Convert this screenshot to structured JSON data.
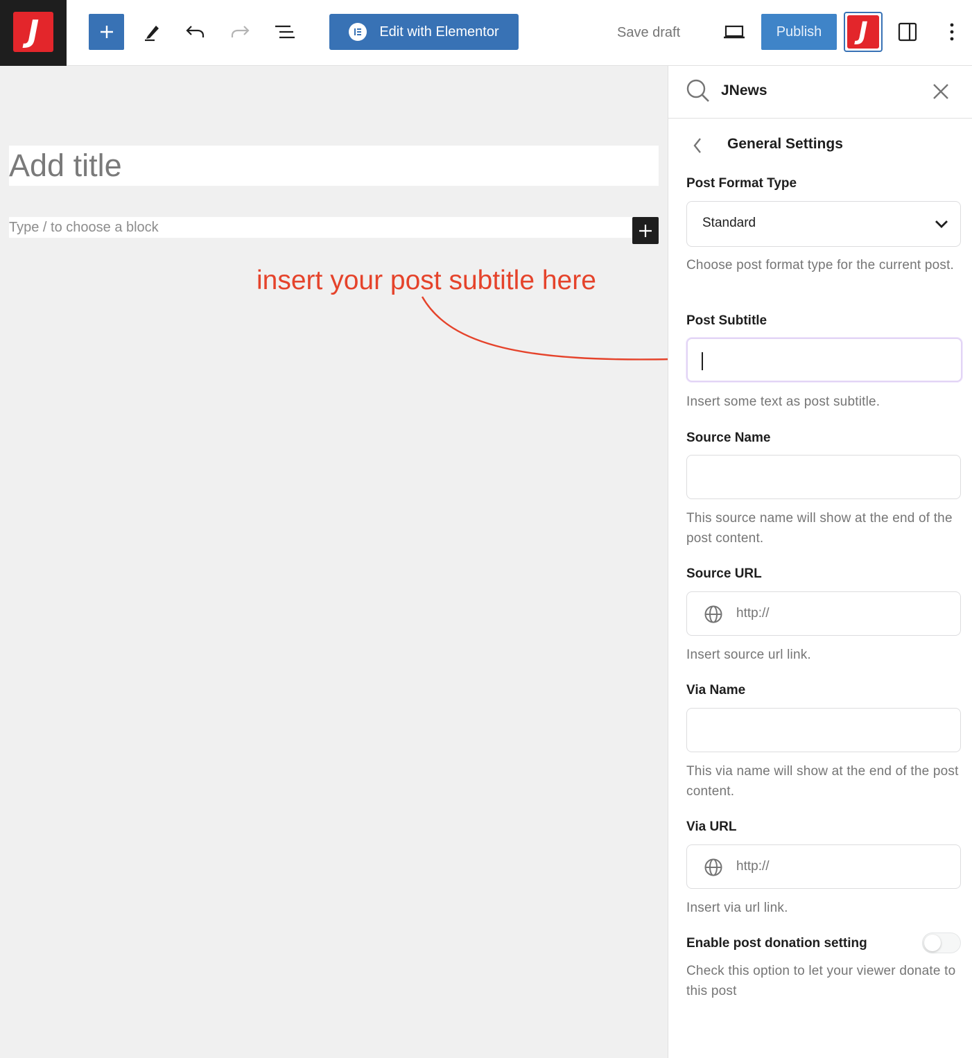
{
  "toolbar": {
    "logo_letter": "J",
    "add_block_label": "+",
    "edit_elementor_label": "Edit with Elementor",
    "save_draft_label": "Save draft",
    "publish_label": "Publish",
    "jnews_toggle_letter": "J"
  },
  "editor": {
    "title_placeholder": "Add title",
    "block_placeholder": "Type / to choose a block",
    "annotation": "insert your post subtitle here"
  },
  "sidebar": {
    "header_title": "JNews",
    "section_title": "General Settings",
    "post_format": {
      "label": "Post Format Type",
      "value": "Standard",
      "help": "Choose post format type for the current post."
    },
    "post_subtitle": {
      "label": "Post Subtitle",
      "value": "",
      "help": "Insert some text as post subtitle."
    },
    "source_name": {
      "label": "Source Name",
      "value": "",
      "help": "This source name will show at the end of the post content."
    },
    "source_url": {
      "label": "Source URL",
      "placeholder": "http://",
      "help": "Insert source url link."
    },
    "via_name": {
      "label": "Via Name",
      "value": "",
      "help": "This via name will show at the end of the post content."
    },
    "via_url": {
      "label": "Via URL",
      "placeholder": "http://",
      "help": "Insert via url link."
    },
    "donation": {
      "label": "Enable post donation setting",
      "enabled": false,
      "help": "Check this option to let your viewer donate to this post"
    }
  },
  "colors": {
    "brand_red": "#e3262b",
    "accent_blue": "#3872b5",
    "publish_blue": "#3f84c8",
    "annotation_red": "#e5432b"
  },
  "icons": [
    "plus-icon",
    "pencil-icon",
    "undo-icon",
    "redo-icon",
    "list-view-icon",
    "elementor-icon",
    "desktop-preview-icon",
    "sidebar-toggle-icon",
    "more-options-icon",
    "search-icon",
    "close-icon",
    "chevron-left-icon",
    "chevron-down-icon",
    "globe-icon"
  ]
}
